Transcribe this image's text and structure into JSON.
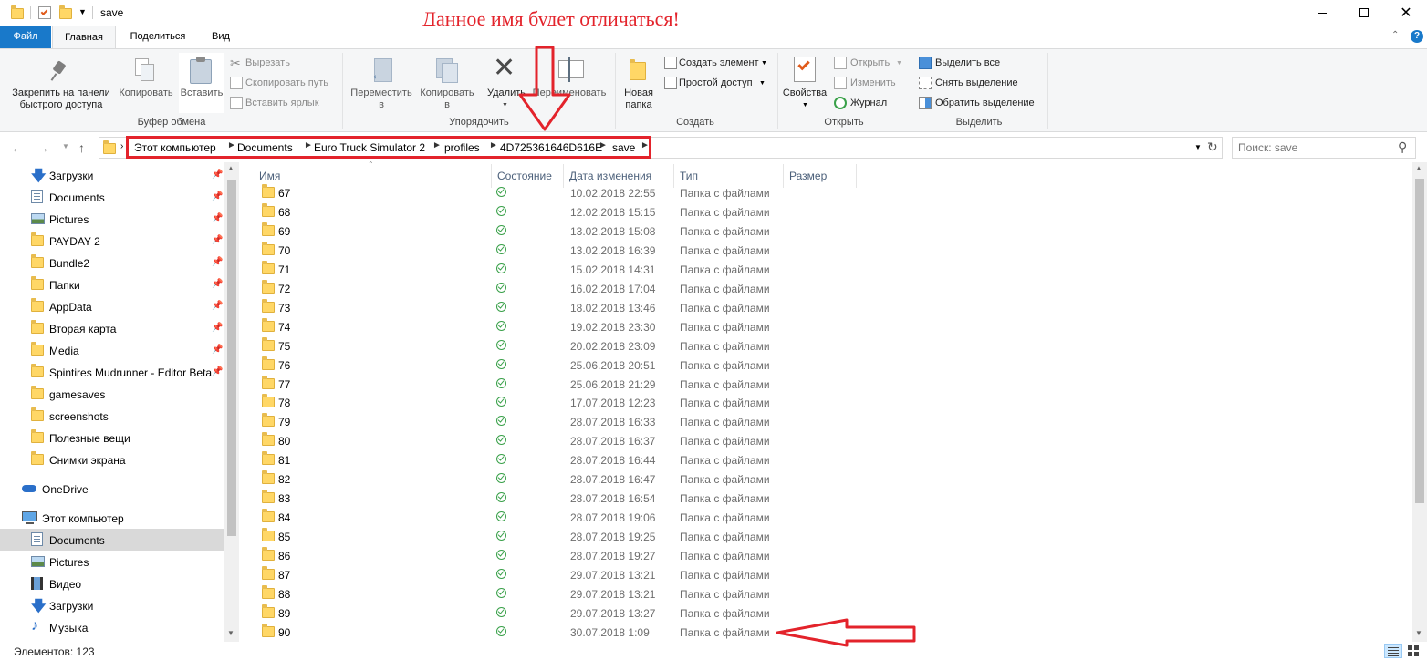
{
  "window": {
    "title": "save",
    "controls": [
      "minimize",
      "maximize",
      "close"
    ]
  },
  "annotation": {
    "text": "Данное имя будет отличаться!",
    "color": "#e3232b"
  },
  "tabs": [
    {
      "label": "Файл"
    },
    {
      "label": "Главная"
    },
    {
      "label": "Поделиться"
    },
    {
      "label": "Вид"
    }
  ],
  "ribbon": {
    "pin_label": "Закрепить на панели быстрого доступа",
    "pin_line1": "Закрепить на панели",
    "pin_line2": "быстрого доступа",
    "copy_label": "Копировать",
    "paste_label": "Вставить",
    "cut_label": "Вырезать",
    "copy_path_label": "Скопировать путь",
    "paste_shortcut_label": "Вставить ярлык",
    "clipboard_group": "Буфер обмена",
    "move_to_line1": "Переместить",
    "move_to_line2": "в",
    "copy_to_line1": "Копировать",
    "copy_to_line2": "в",
    "delete_label": "Удалить",
    "rename_label": "Переименовать",
    "organize_group": "Упорядочить",
    "new_folder_line1": "Новая",
    "new_folder_line2": "папка",
    "new_item_label": "Создать элемент",
    "easy_access_label": "Простой доступ",
    "create_group": "Создать",
    "properties_label": "Свойства",
    "open_label": "Открыть",
    "edit_label": "Изменить",
    "history_label": "Журнал",
    "open_group": "Открыть",
    "select_all_label": "Выделить все",
    "select_none_label": "Снять выделение",
    "invert_selection_label": "Обратить выделение",
    "select_group": "Выделить"
  },
  "address": {
    "crumbs": [
      "Этот компьютер",
      "Documents",
      "Euro Truck Simulator 2",
      "profiles",
      "4D725361646D616E",
      "save"
    ],
    "search_placeholder": "Поиск: save"
  },
  "sidebar": {
    "items": [
      {
        "label": "Загрузки",
        "icon": "download-icon",
        "pinned": true
      },
      {
        "label": "Documents",
        "icon": "document-icon",
        "pinned": true
      },
      {
        "label": "Pictures",
        "icon": "pictures-icon",
        "pinned": true
      },
      {
        "label": "PAYDAY 2",
        "icon": "folder-icon",
        "pinned": true
      },
      {
        "label": "Bundle2",
        "icon": "folder-icon",
        "pinned": true
      },
      {
        "label": "Папки",
        "icon": "folder-icon",
        "pinned": true
      },
      {
        "label": "AppData",
        "icon": "folder-icon",
        "pinned": true
      },
      {
        "label": "Вторая карта",
        "icon": "folder-icon",
        "pinned": true
      },
      {
        "label": "Media",
        "icon": "folder-icon",
        "pinned": true
      },
      {
        "label": "Spintires Mudrunner - Editor Beta",
        "icon": "folder-icon",
        "pinned": true
      },
      {
        "label": "gamesaves",
        "icon": "folder-icon",
        "pinned": false
      },
      {
        "label": "screenshots",
        "icon": "folder-icon",
        "pinned": false
      },
      {
        "label": "Полезные вещи",
        "icon": "folder-icon",
        "pinned": false
      },
      {
        "label": "Снимки экрана",
        "icon": "folder-icon",
        "pinned": false
      }
    ],
    "onedrive": "OneDrive",
    "this_pc": "Этот компьютер",
    "pc_items": [
      {
        "label": "Documents",
        "icon": "document-icon",
        "selected": true
      },
      {
        "label": "Pictures",
        "icon": "pictures-icon",
        "selected": false
      },
      {
        "label": "Видео",
        "icon": "video-icon",
        "selected": false
      },
      {
        "label": "Загрузки",
        "icon": "download-icon",
        "selected": false
      },
      {
        "label": "Музыка",
        "icon": "music-icon",
        "selected": false
      }
    ]
  },
  "columns": {
    "name": "Имя",
    "status": "Состояние",
    "modified": "Дата изменения",
    "type": "Тип",
    "size": "Размер"
  },
  "files": [
    {
      "name": "67",
      "date": "10.02.2018 22:55",
      "type": "Папка с файлами"
    },
    {
      "name": "68",
      "date": "12.02.2018 15:15",
      "type": "Папка с файлами"
    },
    {
      "name": "69",
      "date": "13.02.2018 15:08",
      "type": "Папка с файлами"
    },
    {
      "name": "70",
      "date": "13.02.2018 16:39",
      "type": "Папка с файлами"
    },
    {
      "name": "71",
      "date": "15.02.2018 14:31",
      "type": "Папка с файлами"
    },
    {
      "name": "72",
      "date": "16.02.2018 17:04",
      "type": "Папка с файлами"
    },
    {
      "name": "73",
      "date": "18.02.2018 13:46",
      "type": "Папка с файлами"
    },
    {
      "name": "74",
      "date": "19.02.2018 23:30",
      "type": "Папка с файлами"
    },
    {
      "name": "75",
      "date": "20.02.2018 23:09",
      "type": "Папка с файлами"
    },
    {
      "name": "76",
      "date": "25.06.2018 20:51",
      "type": "Папка с файлами"
    },
    {
      "name": "77",
      "date": "25.06.2018 21:29",
      "type": "Папка с файлами"
    },
    {
      "name": "78",
      "date": "17.07.2018 12:23",
      "type": "Папка с файлами"
    },
    {
      "name": "79",
      "date": "28.07.2018 16:33",
      "type": "Папка с файлами"
    },
    {
      "name": "80",
      "date": "28.07.2018 16:37",
      "type": "Папка с файлами"
    },
    {
      "name": "81",
      "date": "28.07.2018 16:44",
      "type": "Папка с файлами"
    },
    {
      "name": "82",
      "date": "28.07.2018 16:47",
      "type": "Папка с файлами"
    },
    {
      "name": "83",
      "date": "28.07.2018 16:54",
      "type": "Папка с файлами"
    },
    {
      "name": "84",
      "date": "28.07.2018 19:06",
      "type": "Папка с файлами"
    },
    {
      "name": "85",
      "date": "28.07.2018 19:25",
      "type": "Папка с файлами"
    },
    {
      "name": "86",
      "date": "28.07.2018 19:27",
      "type": "Папка с файлами"
    },
    {
      "name": "87",
      "date": "29.07.2018 13:21",
      "type": "Папка с файлами"
    },
    {
      "name": "88",
      "date": "29.07.2018 13:21",
      "type": "Папка с файлами"
    },
    {
      "name": "89",
      "date": "29.07.2018 13:27",
      "type": "Папка с файлами"
    },
    {
      "name": "90",
      "date": "30.07.2018 1:09",
      "type": "Папка с файлами"
    }
  ],
  "status": {
    "item_count": "Элементов: 123"
  },
  "colors": {
    "accent": "#1979ca",
    "annotation_red": "#e3232b",
    "status_green": "#3aa14a",
    "folder_yellow": "#ffd766"
  }
}
